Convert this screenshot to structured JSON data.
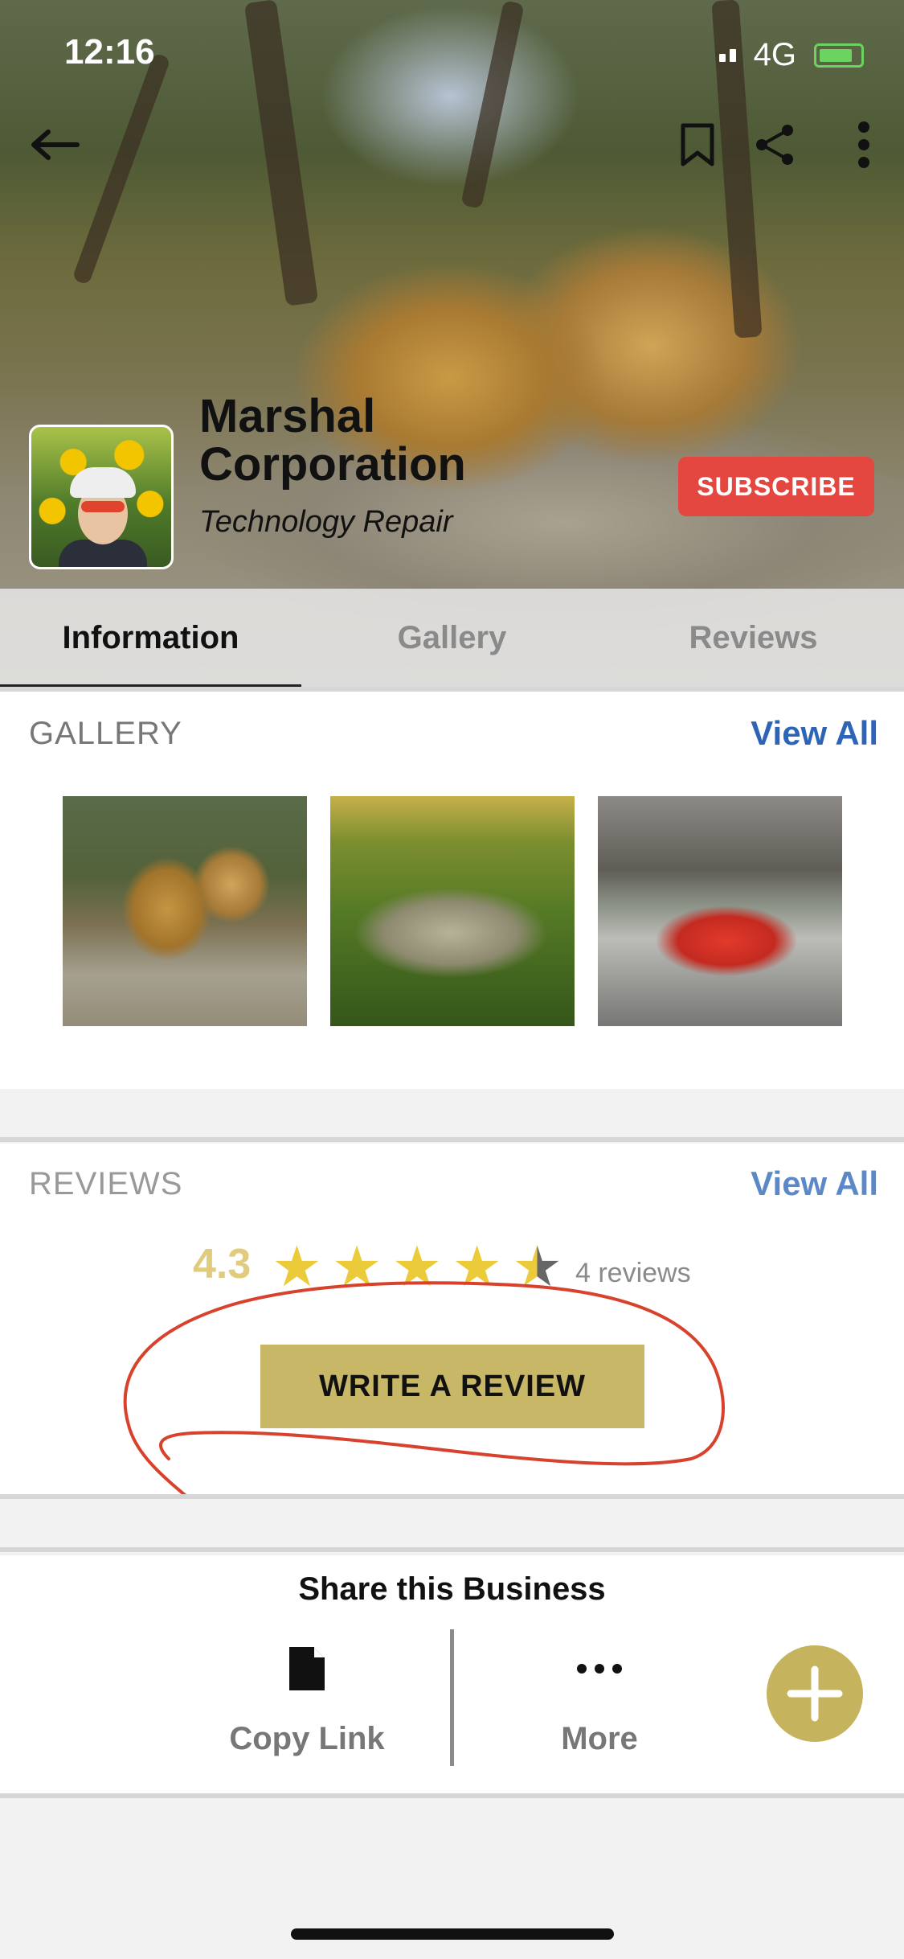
{
  "status_bar": {
    "time": "12:16",
    "network": "4G"
  },
  "header": {
    "back_icon": "arrow-left-icon",
    "bookmark_icon": "bookmark-icon",
    "share_icon": "share-icon",
    "more_icon": "more-vertical-icon"
  },
  "business": {
    "name_line1": "Marshal",
    "name_line2": "Corporation",
    "category": "Technology Repair",
    "subscribe_label": "SUBSCRIBE"
  },
  "tabs": [
    {
      "label": "Information",
      "active": true
    },
    {
      "label": "Gallery",
      "active": false
    },
    {
      "label": "Reviews",
      "active": false
    }
  ],
  "gallery": {
    "title": "GALLERY",
    "view_all": "View All"
  },
  "reviews": {
    "title": "REVIEWS",
    "view_all": "View All",
    "rating": "4.3",
    "count": "4 reviews",
    "stars_filled": 4,
    "write_review": "WRITE A REVIEW"
  },
  "share": {
    "title": "Share this Business",
    "copy_link": "Copy Link",
    "more": "More"
  },
  "colors": {
    "accent_gold": "#c8b766",
    "subscribe_red": "#e3473f",
    "link_blue": "#2e64b7",
    "annotation_red": "#d8422c"
  }
}
